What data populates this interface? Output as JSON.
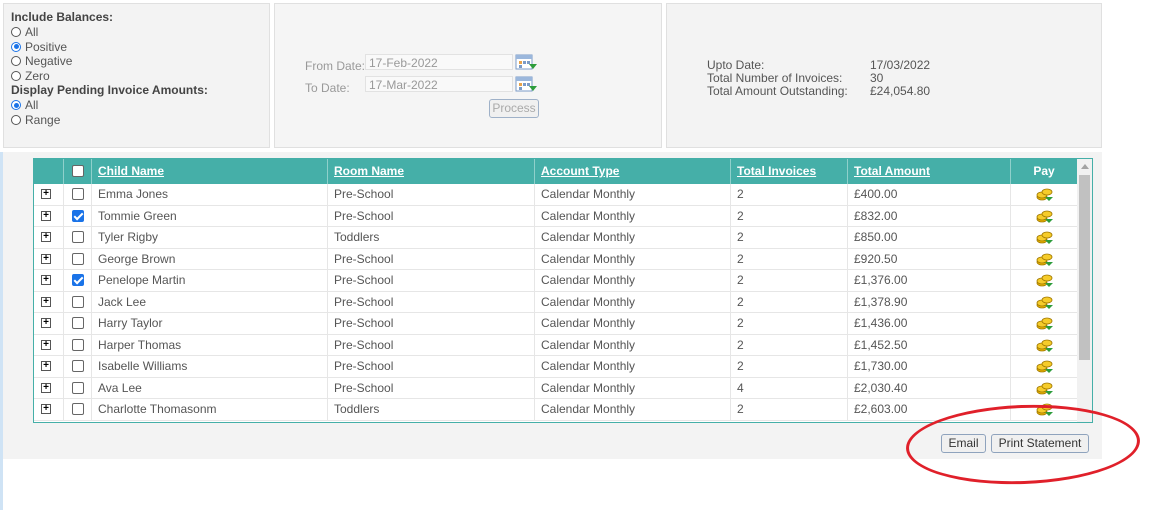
{
  "filters": {
    "include_balances_title": "Include Balances:",
    "balance_options": [
      {
        "label": "All",
        "selected": false
      },
      {
        "label": "Positive",
        "selected": true
      },
      {
        "label": "Negative",
        "selected": false
      },
      {
        "label": "Zero",
        "selected": false
      }
    ],
    "pending_title": "Display Pending Invoice Amounts:",
    "pending_options": [
      {
        "label": "All",
        "selected": true
      },
      {
        "label": "Range",
        "selected": false
      }
    ]
  },
  "dates": {
    "from_label": "From Date:",
    "from_value": "17-Feb-2022",
    "to_label": "To Date:",
    "to_value": "17-Mar-2022",
    "process_label": "Process"
  },
  "summary": {
    "upto_label": "Upto Date:",
    "upto_value": "17/03/2022",
    "invoices_label": "Total Number of Invoices:",
    "invoices_value": "30",
    "outstanding_label": "Total Amount Outstanding:",
    "outstanding_value": "£24,054.80"
  },
  "table": {
    "columns": [
      "Child Name",
      "Room Name",
      "Account Type",
      "Total Invoices",
      "Total Amount",
      "Pay"
    ],
    "rows": [
      {
        "child": "Emma Jones",
        "room": "Pre-School",
        "account": "Calendar Monthly",
        "invoices": "2",
        "amount": "£400.00",
        "checked": false
      },
      {
        "child": "Tommie Green",
        "room": "Pre-School",
        "account": "Calendar Monthly",
        "invoices": "2",
        "amount": "£832.00",
        "checked": true
      },
      {
        "child": "Tyler Rigby",
        "room": "Toddlers",
        "account": "Calendar Monthly",
        "invoices": "2",
        "amount": "£850.00",
        "checked": false
      },
      {
        "child": "George Brown",
        "room": "Pre-School",
        "account": "Calendar Monthly",
        "invoices": "2",
        "amount": "£920.50",
        "checked": false
      },
      {
        "child": "Penelope Martin",
        "room": "Pre-School",
        "account": "Calendar Monthly",
        "invoices": "2",
        "amount": "£1,376.00",
        "checked": true
      },
      {
        "child": "Jack Lee",
        "room": "Pre-School",
        "account": "Calendar Monthly",
        "invoices": "2",
        "amount": "£1,378.90",
        "checked": false
      },
      {
        "child": "Harry Taylor",
        "room": "Pre-School",
        "account": "Calendar Monthly",
        "invoices": "2",
        "amount": "£1,436.00",
        "checked": false
      },
      {
        "child": "Harper Thomas",
        "room": "Pre-School",
        "account": "Calendar Monthly",
        "invoices": "2",
        "amount": "£1,452.50",
        "checked": false
      },
      {
        "child": "Isabelle Williams",
        "room": "Pre-School",
        "account": "Calendar Monthly",
        "invoices": "2",
        "amount": "£1,730.00",
        "checked": false
      },
      {
        "child": "Ava Lee",
        "room": "Pre-School",
        "account": "Calendar Monthly",
        "invoices": "4",
        "amount": "£2,030.40",
        "checked": false
      },
      {
        "child": "Charlotte Thomasonm",
        "room": "Toddlers",
        "account": "Calendar Monthly",
        "invoices": "2",
        "amount": "£2,603.00",
        "checked": false
      }
    ]
  },
  "actions": {
    "email_label": "Email",
    "print_label": "Print Statement"
  },
  "colors": {
    "header_teal": "#45afa8",
    "annotation_red": "#e0202a",
    "radio_blue": "#1a73e8"
  },
  "icons": {
    "pay": "coins-pay-icon",
    "calendar": "calendar-icon",
    "expand": "expand-plus-icon"
  }
}
